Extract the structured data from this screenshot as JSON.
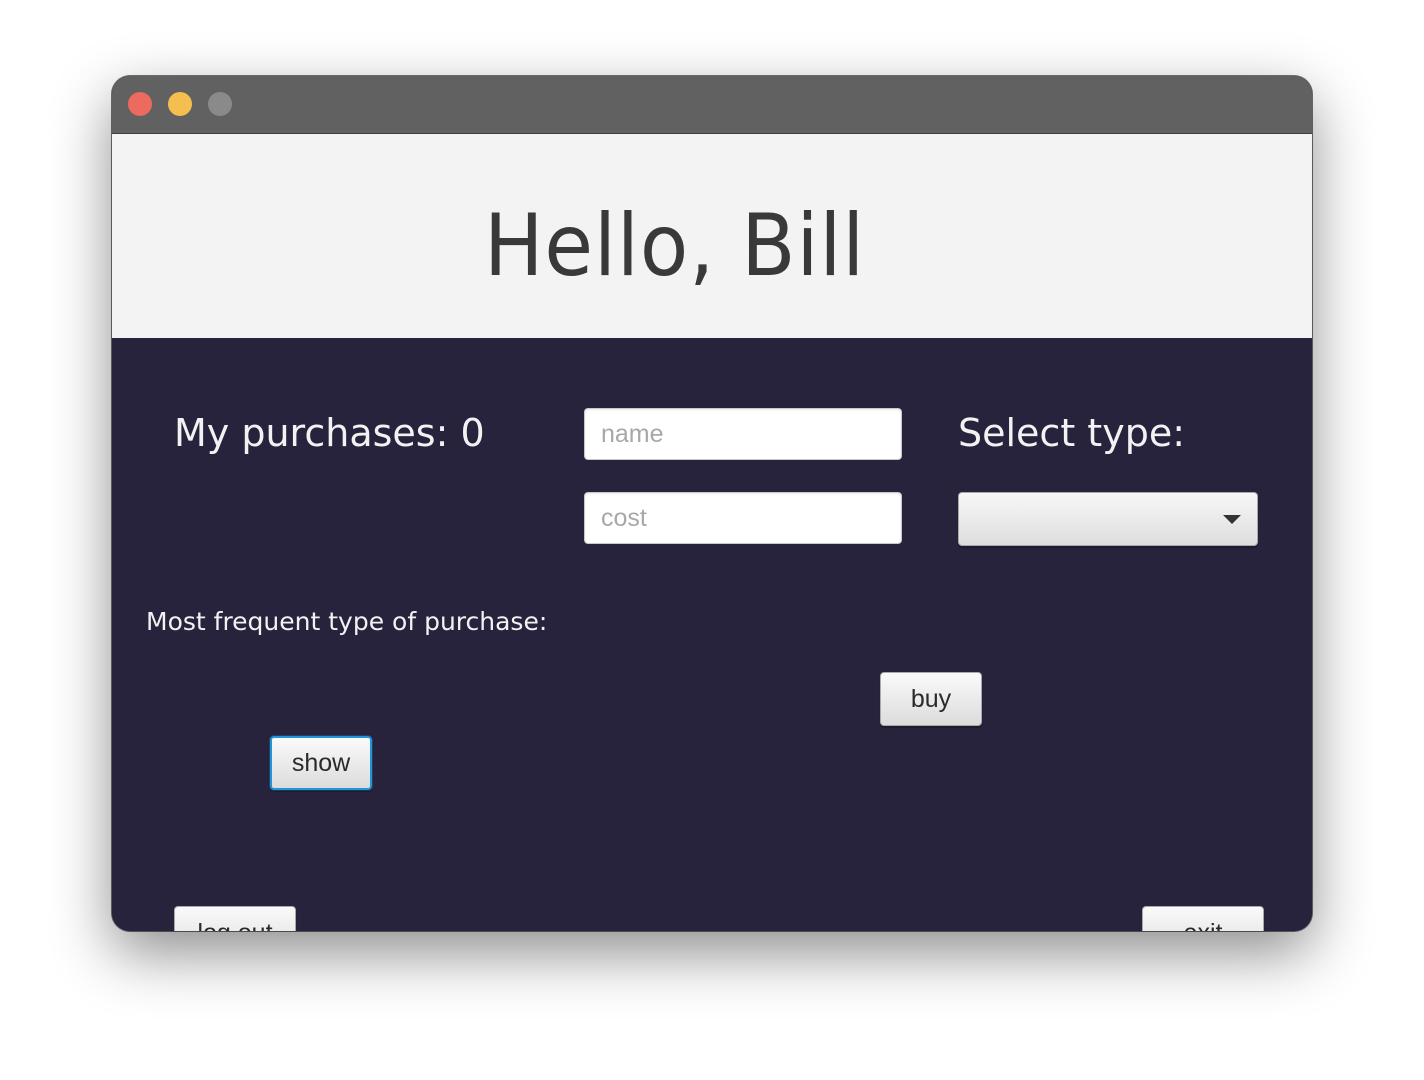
{
  "header": {
    "greeting": "Hello, Bill"
  },
  "purchases": {
    "label": "My purchases: 0"
  },
  "form": {
    "name_placeholder": "name",
    "name_value": "",
    "cost_placeholder": "cost",
    "cost_value": "",
    "select_type_label": "Select type:",
    "type_selected": "",
    "buy_label": "buy"
  },
  "frequent": {
    "label": "Most frequent type of purchase:",
    "show_label": "show"
  },
  "footer": {
    "logout_label": "log out",
    "exit_label": "exit"
  },
  "colors": {
    "titlebar": "#616161",
    "header_background": "#f3f3f3",
    "body_background": "#27233c",
    "focus_ring": "#1e96d8"
  }
}
